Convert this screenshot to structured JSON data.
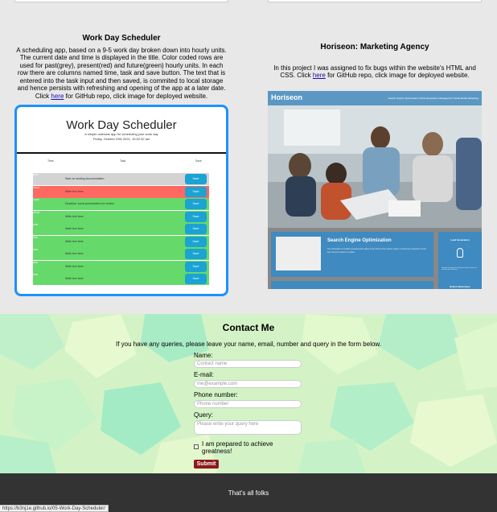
{
  "projects": {
    "scheduler": {
      "title": "Work Day Scheduler",
      "description_before_link": "A scheduling app, based on a 9-5 work day broken down into hourly units. The current date and time is displayed in the title. Color coded rows are used for past(grey), present(red) and future(green) hourly units. In each row there are columns named time, task and save button. The text that is entered into the task input and then saved, is commited to local storage and hence persists with refreshing and opening of the app at a later date. Click ",
      "link_text": "here",
      "description_after_link": " for GitHub repo, click image for deployed website.",
      "screenshot": {
        "app_title": "Work Day Scheduler",
        "app_subtitle": "A simple calendar app for scheduling your work day",
        "app_date": "Friday, October 29th 2021, 10:02:42 am",
        "col_time": "Time",
        "col_task": "Task",
        "col_save": "Save",
        "save_label": "Save",
        "rows": [
          {
            "hour": "9AM",
            "status": "past",
            "task": "Start on landing documentation"
          },
          {
            "hour": "10AM",
            "status": "present",
            "task": "Write text here"
          },
          {
            "hour": "11AM",
            "status": "future",
            "task": "Deadline: some presentation for review"
          },
          {
            "hour": "12PM",
            "status": "future",
            "task": "Write text here"
          },
          {
            "hour": "1PM",
            "status": "future",
            "task": "Write text here"
          },
          {
            "hour": "2PM",
            "status": "future",
            "task": "Write text here"
          },
          {
            "hour": "3PM",
            "status": "future",
            "task": "Write text here"
          },
          {
            "hour": "4PM",
            "status": "future",
            "task": "Write text here"
          },
          {
            "hour": "5PM",
            "status": "future",
            "task": "Write text here"
          }
        ]
      }
    },
    "horiseon": {
      "title": "Horiseon: Marketing Agency",
      "description_before_link": "In this project I was assigned to fix bugs within the website's HTML and CSS. Click ",
      "link_text": "here",
      "description_after_link": " for GitHub repo, click image for deployed website.",
      "screenshot": {
        "logo": "Horiseon",
        "nav": "Search Engine Optimization    Online Reputation Management    Social Media Marketing",
        "card_title": "Search Engine Optimization",
        "card_text": "The information of mobile searches that relates to the basis of the search engine to determine relevance for the item and put content in a place.",
        "side_title": "Lead Generation",
        "side_text": "Inbound strategies for lead generation require the work for your business.",
        "side_title_2": "Brand Awareness"
      }
    }
  },
  "contact": {
    "heading": "Contact Me",
    "intro": "If you have any queries, please leave your name, email, number and query in the form below.",
    "name_label": "Name:",
    "name_placeholder": "Contact name",
    "email_label": "E-mail:",
    "email_placeholder": "me@example.com",
    "phone_label": "Phone number:",
    "phone_placeholder": "Phone number",
    "query_label": "Query:",
    "query_placeholder": "Please write your query here",
    "checkbox_label": "I am prepared to achieve greatness!",
    "submit_label": "Submit"
  },
  "footer": {
    "message": "That's all folks"
  },
  "status_url": "https://b3nj1e.github.io/05-Work-Day-Scheduler/",
  "colors": {
    "accent_border": "#1e90ff",
    "past": "#d3d3d3",
    "present": "#ff6961",
    "future": "#66d96b",
    "submit": "#8b1a1a",
    "footer": "#333333"
  }
}
